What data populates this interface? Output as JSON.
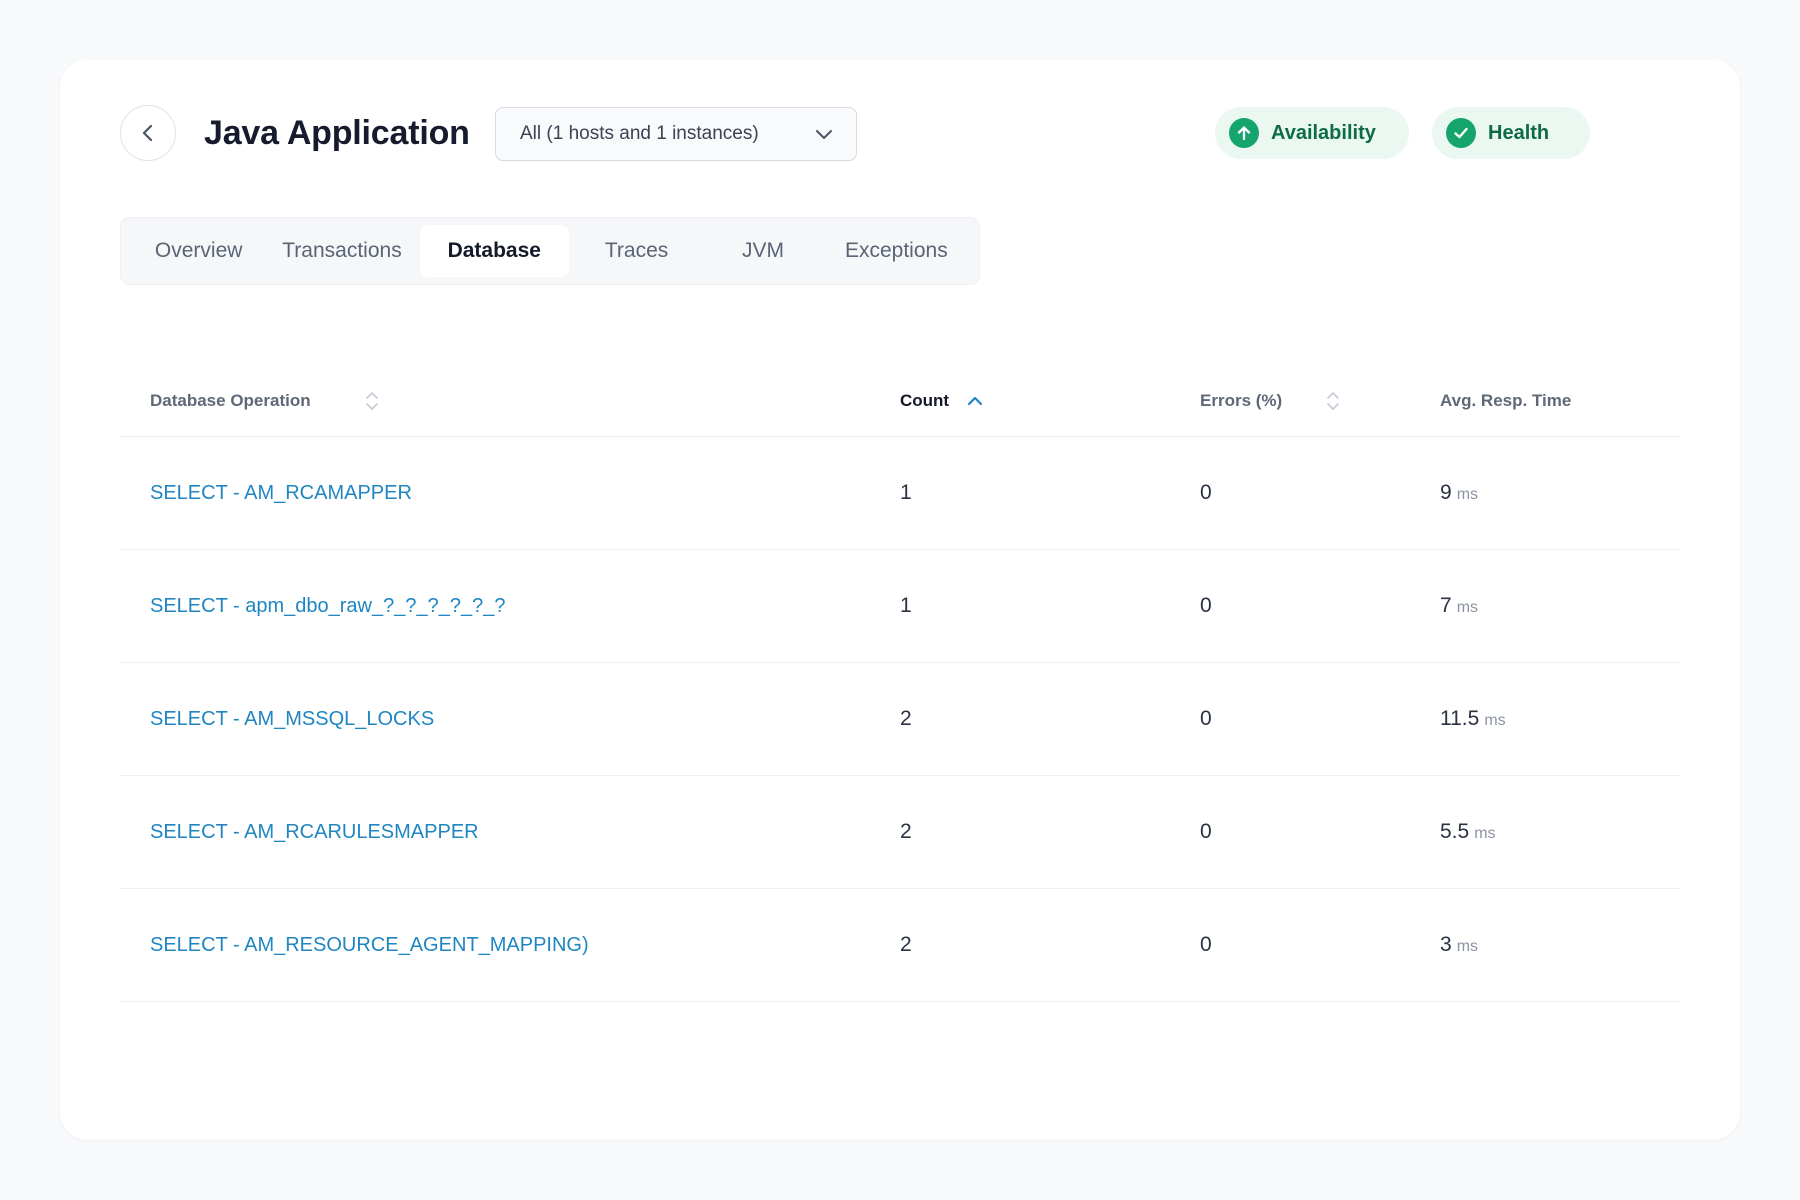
{
  "header": {
    "title": "Java Application",
    "host_filter": "All (1 hosts and 1 instances)",
    "availability_label": "Availability",
    "health_label": "Health"
  },
  "tabs": [
    {
      "label": "Overview",
      "active": false
    },
    {
      "label": "Transactions",
      "active": false
    },
    {
      "label": "Database",
      "active": true
    },
    {
      "label": "Traces",
      "active": false
    },
    {
      "label": "JVM",
      "active": false
    },
    {
      "label": "Exceptions",
      "active": false
    }
  ],
  "table": {
    "columns": [
      {
        "label": "Database Operation",
        "sort": "none"
      },
      {
        "label": "Count",
        "sort": "ascending"
      },
      {
        "label": "Errors (%)",
        "sort": "none"
      },
      {
        "label": "Avg. Resp. Time",
        "sort": null
      }
    ],
    "rows": [
      {
        "operation": "SELECT - AM_RCAMAPPER",
        "count": "1",
        "errors": "0",
        "avg_time": "9",
        "unit": "ms"
      },
      {
        "operation": "SELECT - apm_dbo_raw_?_?_?_?_?_?",
        "count": "1",
        "errors": "0",
        "avg_time": "7",
        "unit": "ms"
      },
      {
        "operation": "SELECT - AM_MSSQL_LOCKS",
        "count": "2",
        "errors": "0",
        "avg_time": "11.5",
        "unit": "ms"
      },
      {
        "operation": "SELECT - AM_RCARULESMAPPER",
        "count": "2",
        "errors": "0",
        "avg_time": "5.5",
        "unit": "ms"
      },
      {
        "operation": "SELECT - AM_RESOURCE_AGENT_MAPPING)",
        "count": "2",
        "errors": "0",
        "avg_time": "3",
        "unit": "ms"
      }
    ]
  },
  "colors": {
    "link": "#1f86c2",
    "status_green": "#14a46c",
    "sort_active": "#1f86c2"
  },
  "icons": {
    "back": "chevron-left-icon",
    "dropdown": "chevron-down-icon",
    "availability": "arrow-up-circle-icon",
    "health": "check-circle-icon"
  }
}
